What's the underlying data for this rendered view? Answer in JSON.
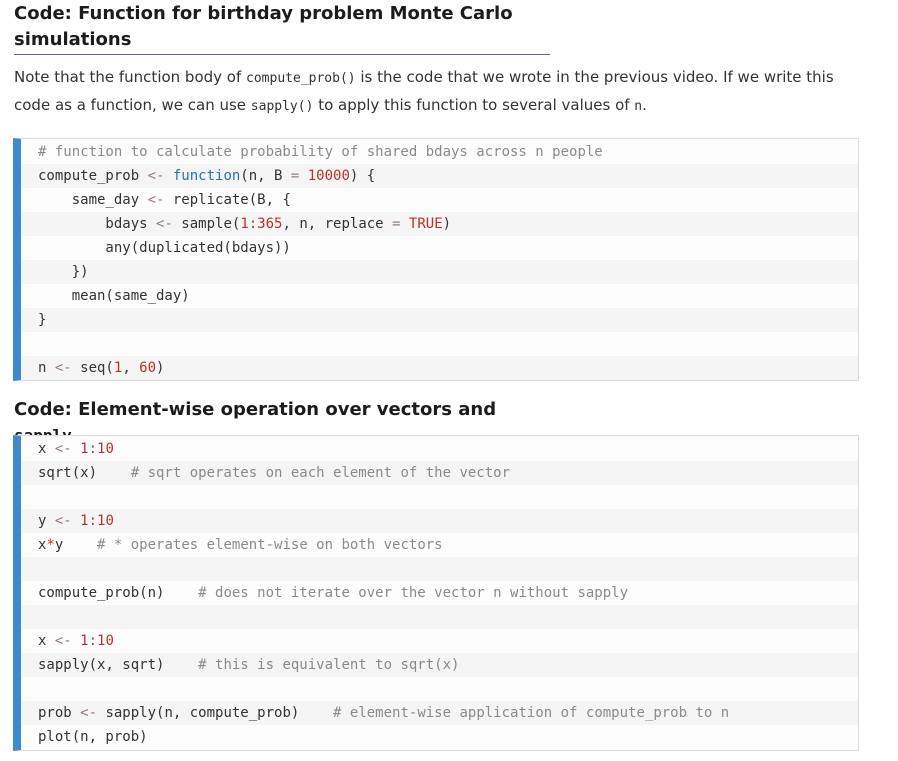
{
  "heading1": "Code: Function for birthday problem Monte Carlo simulations",
  "paragraph": {
    "p1": "Note that the function body of ",
    "code1": "compute_prob()",
    "p2": " is the code that we wrote in the previous video. If we write this code as a function, we can use ",
    "code2": "sapply()",
    "p3": " to apply this function to several values of ",
    "code3": "n",
    "p4": "."
  },
  "heading2": {
    "text": "Code: Element-wise operation over vectors and ",
    "code": "sapply"
  },
  "block1": {
    "comment": "# function to calculate probability of shared bdays across n people",
    "l2a": "compute_prob ",
    "l2op": "<-",
    "l2kw": " function",
    "l2b": "(n, B ",
    "l2eq": "=",
    "l2c": " ",
    "l2num": "10000",
    "l2d": ") {",
    "l3a": "    same_day ",
    "l3op": "<-",
    "l3b": " replicate(B, {",
    "l4a": "        bdays ",
    "l4op": "<-",
    "l4b": " sample(",
    "l4num": "1:365",
    "l4c": ", n, replace ",
    "l4eq": "=",
    "l4d": " ",
    "l4true": "TRUE",
    "l4e": ")",
    "l5": "        any(duplicated(bdays))",
    "l6": "    })",
    "l7": "    mean(same_day)",
    "l8": "}",
    "l10a": "n ",
    "l10op": "<-",
    "l10b": " seq(",
    "l10n1": "1",
    "l10c": ", ",
    "l10n2": "60",
    "l10d": ")"
  },
  "block2": {
    "l1a": "x ",
    "l1op": "<-",
    "l1b": " ",
    "l1num": "1:10",
    "l2code": "sqrt(x)    ",
    "l2comment": "# sqrt operates on each element of the vector",
    "l4a": "y ",
    "l4op": "<-",
    "l4b": " ",
    "l4num": "1:10",
    "l5a": "x",
    "l5op": "*",
    "l5b": "y    ",
    "l5comment": "# * operates element-wise on both vectors",
    "l7code": "compute_prob(n)    ",
    "l7comment": "# does not iterate over the vector n without sapply",
    "l9a": "x ",
    "l9op": "<-",
    "l9b": " ",
    "l9num": "1:10",
    "l10code": "sapply(x, sqrt)    ",
    "l10comment": "# this is equivalent to sqrt(x)",
    "l12a": "prob ",
    "l12op": "<-",
    "l12b": " sapply(n, compute_prob)    ",
    "l12comment": "# element-wise application of compute_prob to n",
    "l13": "plot(n, prob)"
  },
  "colors": {
    "accent_bar": "#3d8bcc",
    "number": "#b5322a",
    "keyword": "#1f74b8",
    "comment": "#8a8a8a"
  }
}
